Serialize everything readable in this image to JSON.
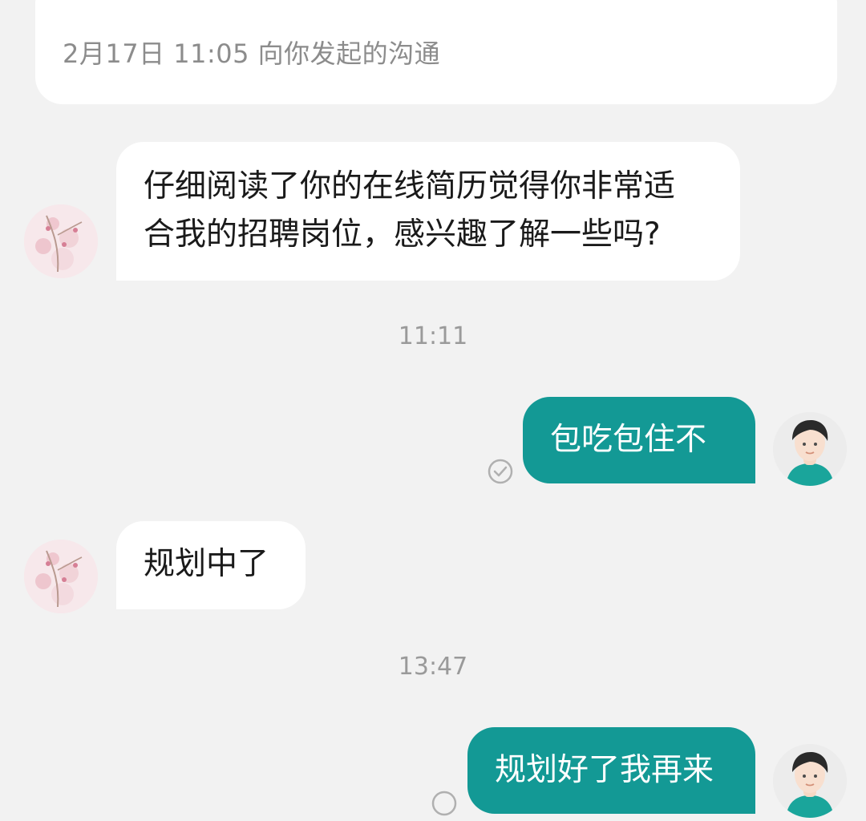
{
  "header": {
    "meta": "2月17日 11:05 向你发起的沟通"
  },
  "messages": [
    {
      "side": "in",
      "lines": [
        "仔细阅读了你的在线简历觉得你非常适",
        "合我的招聘岗位，感兴趣了解一些吗?"
      ]
    },
    {
      "timestamp": "11:11"
    },
    {
      "side": "out",
      "text": "包吃包住不",
      "status": "read"
    },
    {
      "side": "in",
      "text": "规划中了"
    },
    {
      "timestamp": "13:47"
    },
    {
      "side": "out",
      "text": "规划好了我再来",
      "status": "sending"
    }
  ],
  "icons": {
    "recruiter_avatar": "cherry-blossom-avatar-icon",
    "user_avatar": "user-avatar-icon",
    "read_status": "check-circle-icon",
    "pending_status": "empty-circle-icon"
  },
  "colors": {
    "background": "#f2f2f2",
    "incoming_bubble": "#ffffff",
    "outgoing_bubble": "#139995",
    "timestamp": "#9a9a9a"
  }
}
